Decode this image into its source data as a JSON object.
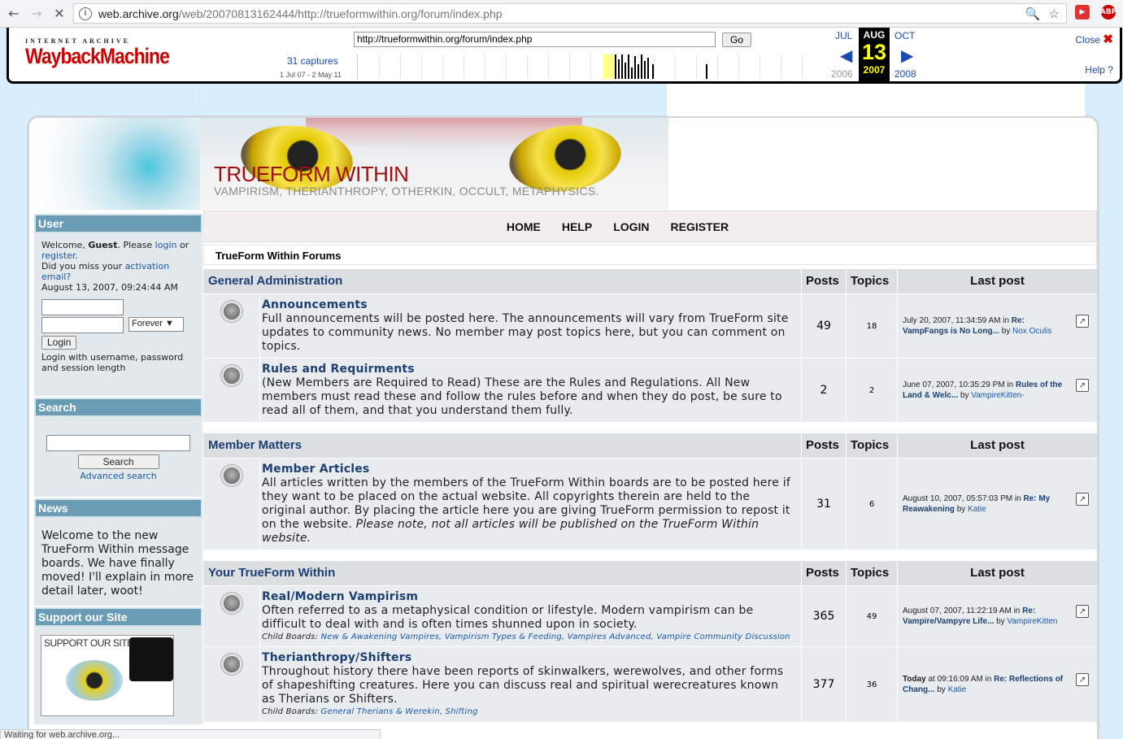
{
  "browser": {
    "url_host": "web.archive.org",
    "url_rest": "/web/20070813162444/http://trueformwithin.org/forum/index.php",
    "status_text": "Waiting for web.archive.org..."
  },
  "wayback": {
    "logo_top": "INTERNET ARCHIVE",
    "logo_main": "WaybackMachine",
    "url_value": "http://trueformwithin.org/forum/index.php",
    "go_label": "Go",
    "captures": "31 captures",
    "range": "1 Jul 07 - 2 May 11",
    "prev_month": "JUL",
    "cur_month": "AUG",
    "next_month": "OCT",
    "day": "13",
    "prev_year": "2006",
    "cur_year": "2007",
    "next_year": "2008",
    "close_label": "Close",
    "help_label": "Help"
  },
  "banner": {
    "title": "TRUEFORM WITHIN",
    "subtitle": "VAMPIRISM, THERIANTHROPY, OTHERKIN, OCCULT, METAPHYSICS."
  },
  "sidebar": {
    "user_header": "User",
    "welcome_prefix": "Welcome,",
    "guest": "Guest",
    "welcome_mid": ". Please",
    "login_link": "login",
    "or": "or",
    "register_link": "register",
    "miss_activation": "Did you miss your",
    "activation_link": "activation email?",
    "date": "August 13, 2007, 09:24:44 AM",
    "forever": "Forever",
    "login_button": "Login",
    "login_help": "Login with username, password and session length",
    "search_header": "Search",
    "search_button": "Search",
    "advanced_search": "Advanced search",
    "news_header": "News",
    "news_text": "Welcome to the new TrueForm Within message boards. We have finally moved! I'll explain in more detail later, woot!",
    "support_header": "Support our Site",
    "support_img_text": "SUPPORT OUR SITE"
  },
  "menu": {
    "home": "HOME",
    "help": "HELP",
    "login": "LOGIN",
    "register": "REGISTER"
  },
  "breadcrumb": "TrueForm Within Forums",
  "col_posts": "Posts",
  "col_topics": "Topics",
  "col_last": "Last post",
  "categories": [
    {
      "name": "General Administration",
      "boards": [
        {
          "name": "Announcements",
          "desc": "Full announcements will be posted here. The announcements will vary from TrueForm site updates to community news. No member may post topics here, but you can comment on topics.",
          "posts": "49",
          "topics": "18",
          "last_date": "July 20, 2007, 11:34:59 AM in",
          "last_topic": "Re: VampFangs is No Long...",
          "last_by": "by",
          "last_user": "Nox Oculis"
        },
        {
          "name": "Rules and Requirments",
          "desc": "(New Members are Required to Read) These are the Rules and Regulations. All New members must read these and follow the rules before and when they do post, be sure to read all of them, and that you understand them fully.",
          "posts": "2",
          "topics": "2",
          "last_date": "June 07, 2007, 10:35:29 PM in",
          "last_topic": "Rules of the Land & Welc...",
          "last_by": "by",
          "last_user": "VampireKitten-"
        }
      ]
    },
    {
      "name": "Member Matters",
      "boards": [
        {
          "name": "Member Articles",
          "desc": "All articles written by the members of the TrueForm Within boards are to be posted here if they want to be placed on the actual website. All copyrights therein are held to the original author. By placing the article here you are giving TrueForm permission to repost it on the website.",
          "desc_italic": "Please note, not all articles will be published on the TrueForm Within website.",
          "posts": "31",
          "topics": "6",
          "last_date": "August 10, 2007, 05:57:03 PM in",
          "last_topic": "Re: My Reawakening",
          "last_by": "by",
          "last_user": "Katie"
        }
      ]
    },
    {
      "name": "Your TrueForm Within",
      "boards": [
        {
          "name": "Real/Modern Vampirism",
          "desc": "Often referred to as a metaphysical condition or lifestyle. Modern vampirism can be difficult to deal with and is often times shunned upon in society.",
          "child_label": "Child Boards:",
          "children": "New & Awakening Vampires, Vampirism Types & Feeding, Vampires Advanced, Vampire Community Discussion",
          "posts": "365",
          "topics": "49",
          "last_date": "August 07, 2007, 11:22:19 AM in",
          "last_topic": "Re: Vampire/Vampyre Life...",
          "last_by": "by",
          "last_user": "VampireKitten"
        },
        {
          "name": "Therianthropy/Shifters",
          "desc": "Throughout history there have been reports of skinwalkers, werewolves, and other forms of shapeshifting creatures. Here you can discuss real and spiritual werecreatures known as Therians or Shifters.",
          "child_label": "Child Boards:",
          "children": "General Therians & Werekin, Shifting",
          "posts": "377",
          "topics": "36",
          "last_date_bold": "Today",
          "last_date": "at 09:16:09 AM in",
          "last_topic": "Re: Reflections of Chang...",
          "last_by": "by",
          "last_user": "Katie"
        }
      ]
    }
  ]
}
